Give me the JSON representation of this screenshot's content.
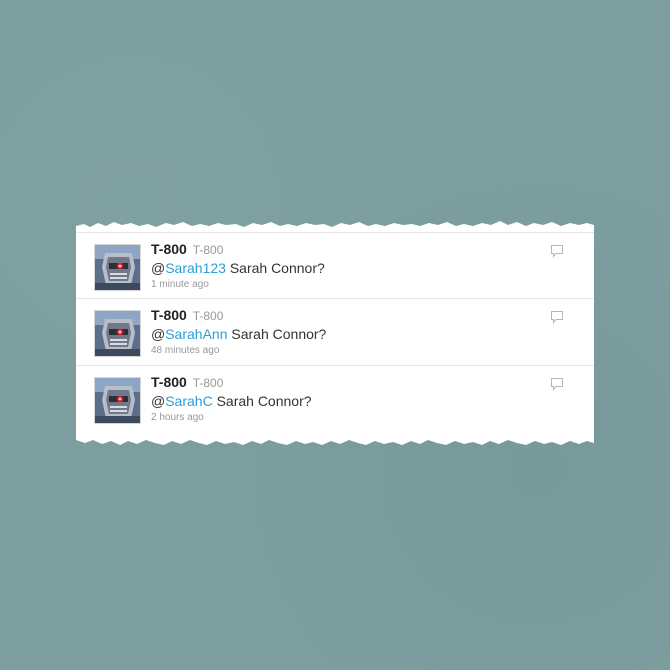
{
  "tweets": [
    {
      "name": "T-800",
      "handle": "T-800",
      "at": "@",
      "mention": "Sarah123",
      "text": " Sarah Connor?",
      "time": "1 minute ago",
      "reply_icon": "reply-bubble-icon"
    },
    {
      "name": "T-800",
      "handle": "T-800",
      "at": "@",
      "mention": "SarahAnn",
      "text": " Sarah Connor?",
      "time": "48 minutes ago",
      "reply_icon": "reply-bubble-icon"
    },
    {
      "name": "T-800",
      "handle": "T-800",
      "at": "@",
      "mention": "SarahC",
      "text": " Sarah Connor?",
      "time": "2 hours ago",
      "reply_icon": "reply-bubble-icon"
    }
  ],
  "colors": {
    "background": "#7c9e9f",
    "mention": "#2a9fd6",
    "name": "#222222",
    "meta": "#999999"
  }
}
